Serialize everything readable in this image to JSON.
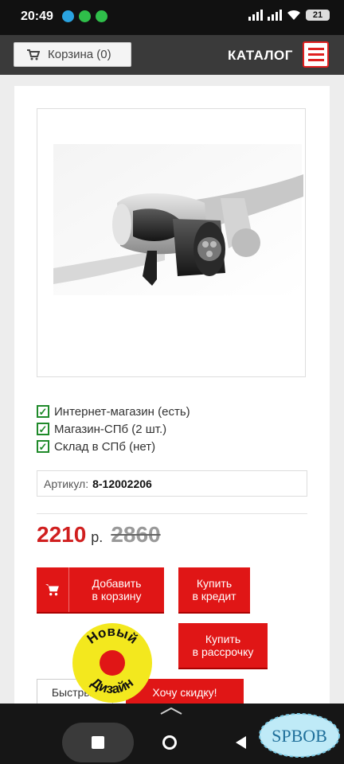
{
  "status_bar": {
    "time": "20:49",
    "battery": "21"
  },
  "nav": {
    "cart_label": "Корзина (0)",
    "catalog_label": "КАТАЛОГ"
  },
  "stock": [
    {
      "label": "Интернет-магазин (есть)"
    },
    {
      "label": "Магазин-СПб (2 шт.)"
    },
    {
      "label": "Склад в СПб (нет)"
    }
  ],
  "sku": {
    "label": "Артикул:",
    "value": "8-12002206"
  },
  "price": {
    "current": "2210",
    "unit": "р.",
    "old": "2860"
  },
  "buttons": {
    "add_to_cart_line1": "Добавить",
    "add_to_cart_line2": "в корзину",
    "credit_line1": "Купить",
    "credit_line2": "в кредит",
    "installment_line1": "Купить",
    "installment_line2": "в рассрочку",
    "quick": "Быстрый",
    "discount": "Хочу скидку!"
  },
  "badge": {
    "word1": "Новый",
    "word2": "Дизайн"
  },
  "watermark": {
    "text": "SPBOB"
  },
  "colors": {
    "accent": "#e01616",
    "nav_bg": "#3a3a3a",
    "price": "#d01f1f",
    "check": "#1f8a2a"
  }
}
